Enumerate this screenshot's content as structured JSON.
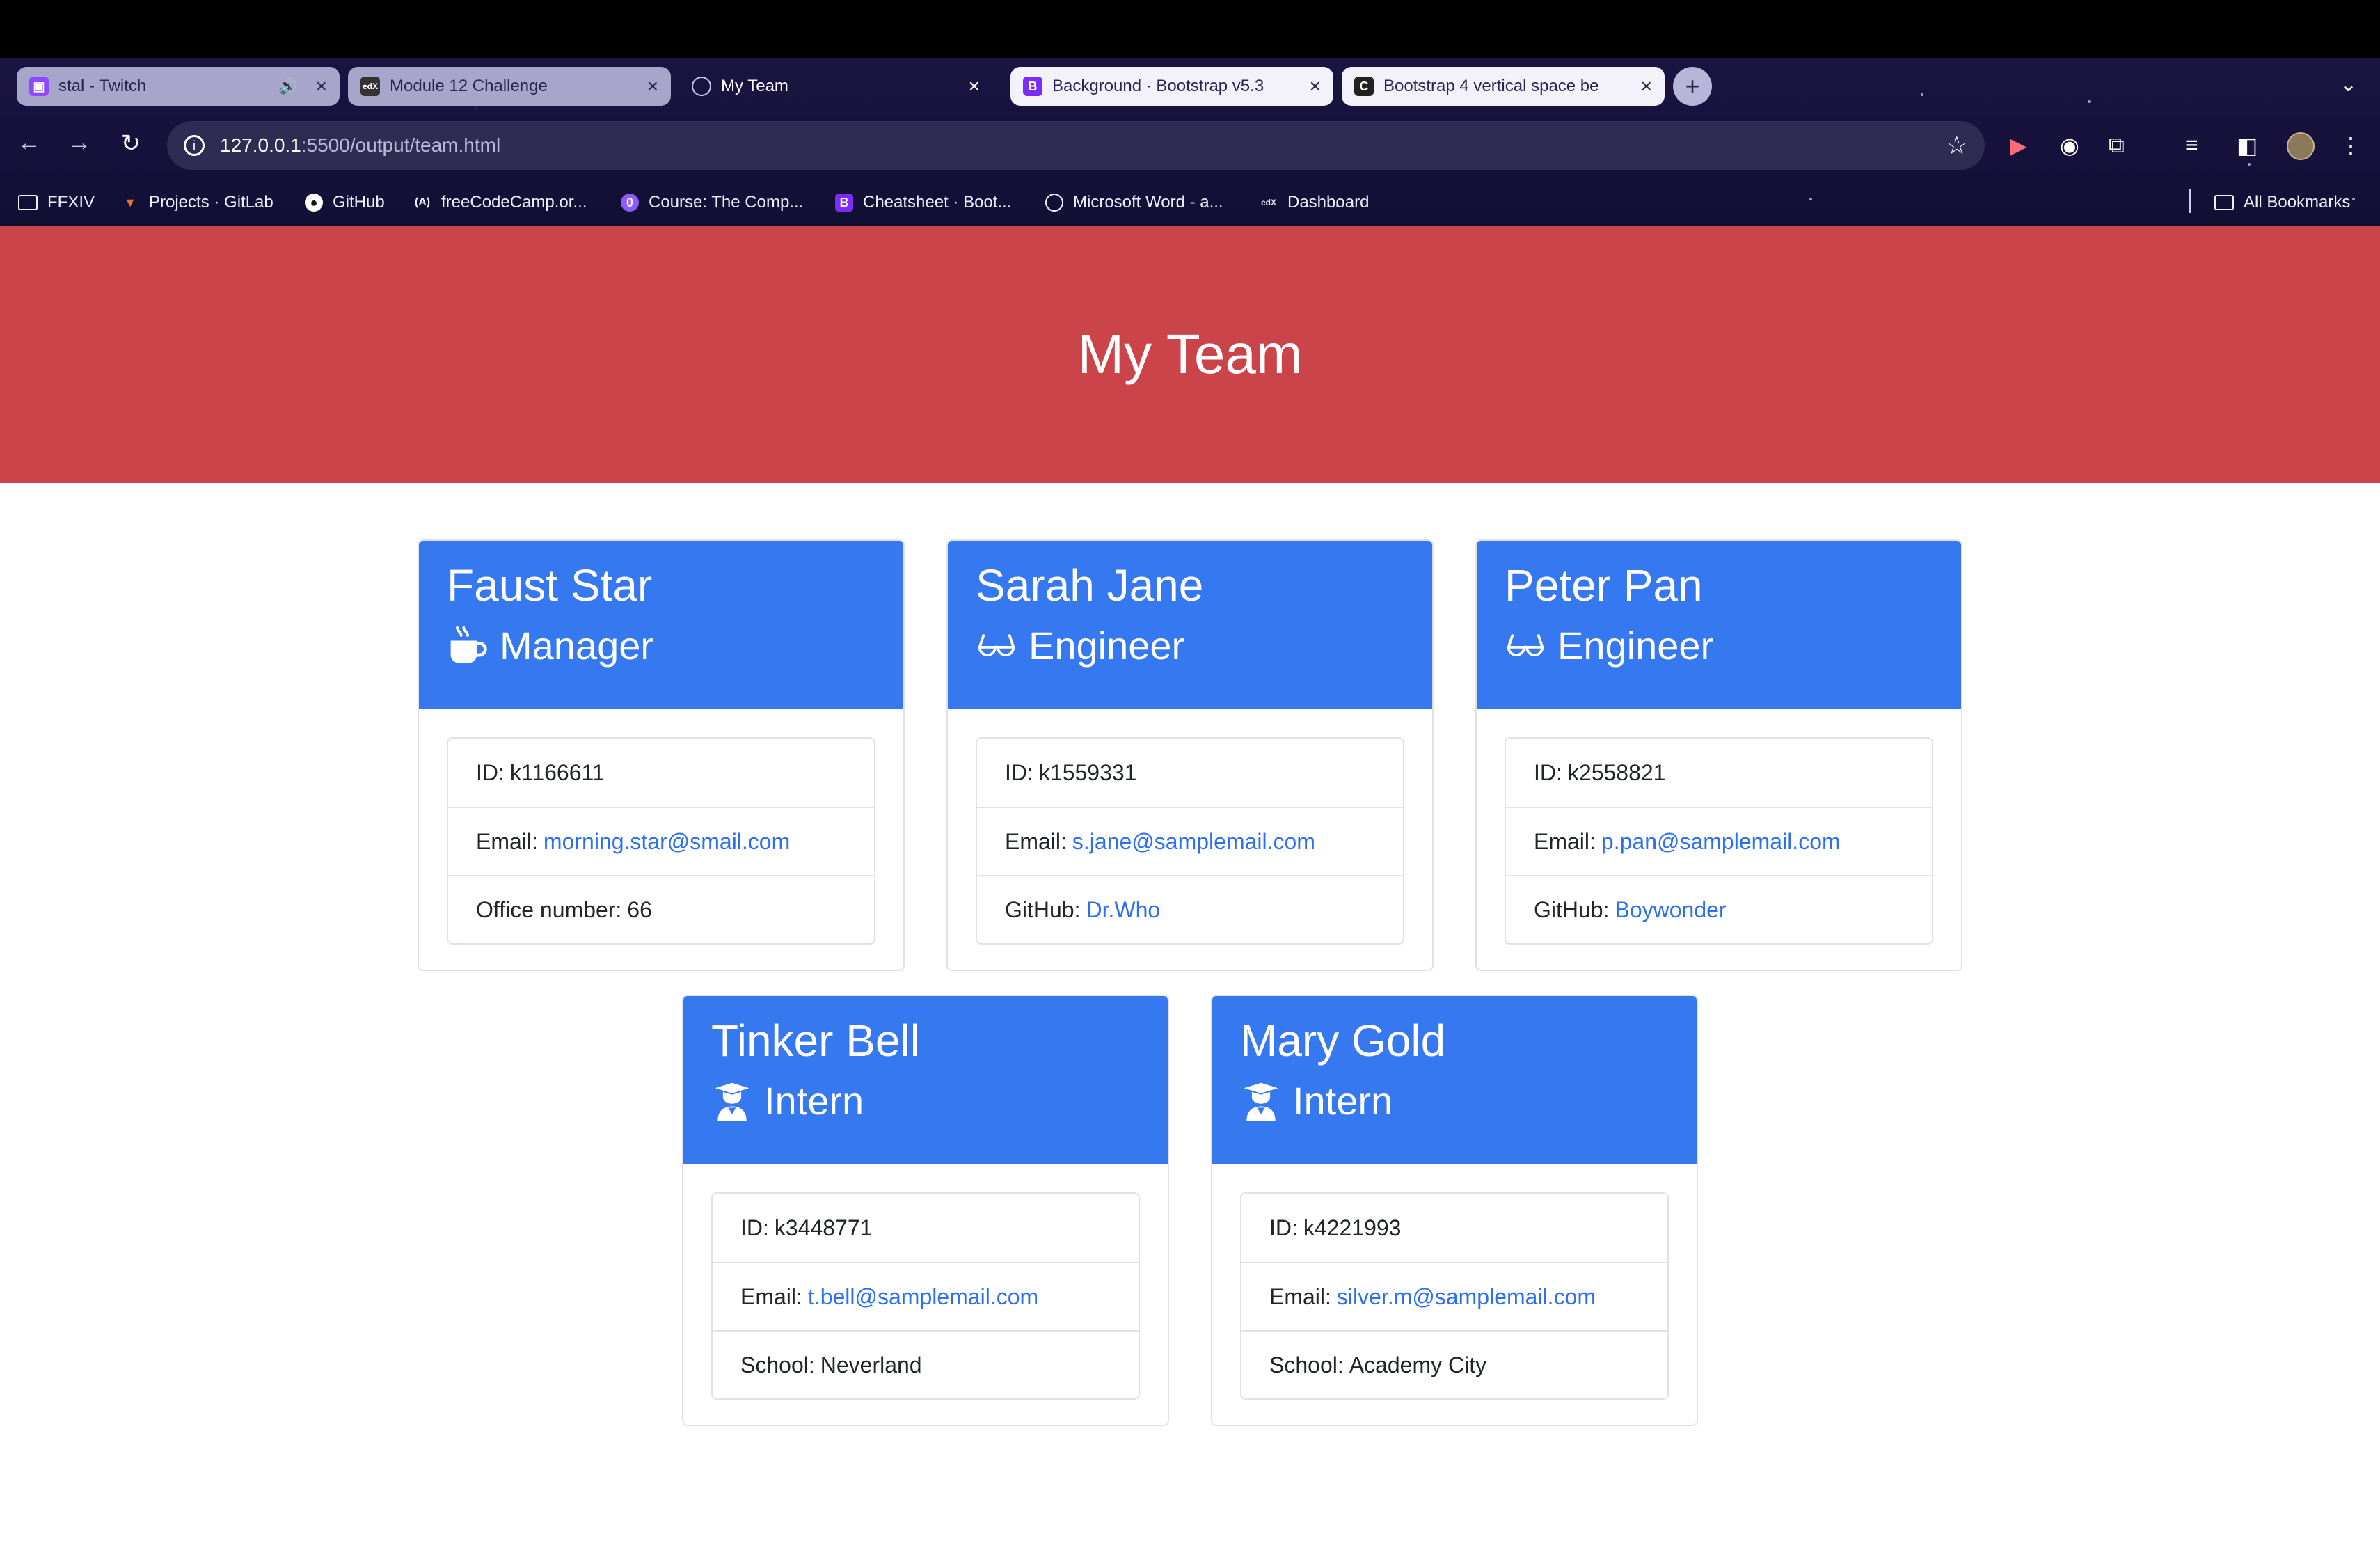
{
  "browser": {
    "tabs": [
      {
        "title": "stal - Twitch",
        "state": "light"
      },
      {
        "title": "Module 12 Challenge",
        "state": "light"
      },
      {
        "title": "My Team",
        "state": "active"
      },
      {
        "title": "Background · Bootstrap v5.3",
        "state": "light2"
      },
      {
        "title": "Bootstrap 4 vertical space be",
        "state": "light2"
      }
    ],
    "address": {
      "host": "127.0.0.1",
      "path": ":5500/output/team.html"
    },
    "bookmarks": [
      {
        "label": "FFXIV",
        "icon": "folder-icon"
      },
      {
        "label": "Projects · GitLab",
        "icon": "gitlab-icon"
      },
      {
        "label": "GitHub",
        "icon": "github-icon"
      },
      {
        "label": "freeCodeCamp.or...",
        "icon": "freecodecamp-icon"
      },
      {
        "label": "Course: The Comp...",
        "icon": "course-icon"
      },
      {
        "label": "Cheatsheet · Boot...",
        "icon": "bootstrap-icon"
      },
      {
        "label": "Microsoft Word - a...",
        "icon": "globe-icon"
      },
      {
        "label": "Dashboard",
        "icon": "edx-icon"
      },
      {
        "label": "All Bookmarks",
        "icon": "folder-icon"
      }
    ]
  },
  "page": {
    "title": "My Team",
    "members": [
      {
        "name": "Faust Star",
        "role": "Manager",
        "role_icon": "mug-icon",
        "id_label": "ID:",
        "id": "k1166611",
        "email_label": "Email:",
        "email": "morning.star@smail.com",
        "extra_label": "Office number:",
        "extra": "66",
        "extra_is_link": false
      },
      {
        "name": "Sarah Jane",
        "role": "Engineer",
        "role_icon": "glasses-icon",
        "id_label": "ID:",
        "id": "k1559331",
        "email_label": "Email:",
        "email": "s.jane@samplemail.com",
        "extra_label": "GitHub:",
        "extra": "Dr.Who",
        "extra_is_link": true
      },
      {
        "name": "Peter Pan",
        "role": "Engineer",
        "role_icon": "glasses-icon",
        "id_label": "ID:",
        "id": "k2558821",
        "email_label": "Email:",
        "email": "p.pan@samplemail.com",
        "extra_label": "GitHub:",
        "extra": "Boywonder",
        "extra_is_link": true
      },
      {
        "name": "Tinker Bell",
        "role": "Intern",
        "role_icon": "graduate-icon",
        "id_label": "ID:",
        "id": "k3448771",
        "email_label": "Email:",
        "email": "t.bell@samplemail.com",
        "extra_label": "School:",
        "extra": "Neverland",
        "extra_is_link": false
      },
      {
        "name": "Mary Gold",
        "role": "Intern",
        "role_icon": "graduate-icon",
        "id_label": "ID:",
        "id": "k4221993",
        "email_label": "Email:",
        "email": "silver.m@samplemail.com",
        "extra_label": "School:",
        "extra": "Academy City",
        "extra_is_link": false
      }
    ]
  },
  "colors": {
    "header_bg": "#cb444a",
    "card_header_bg": "#3578f0",
    "link": "#2d6ff2"
  }
}
